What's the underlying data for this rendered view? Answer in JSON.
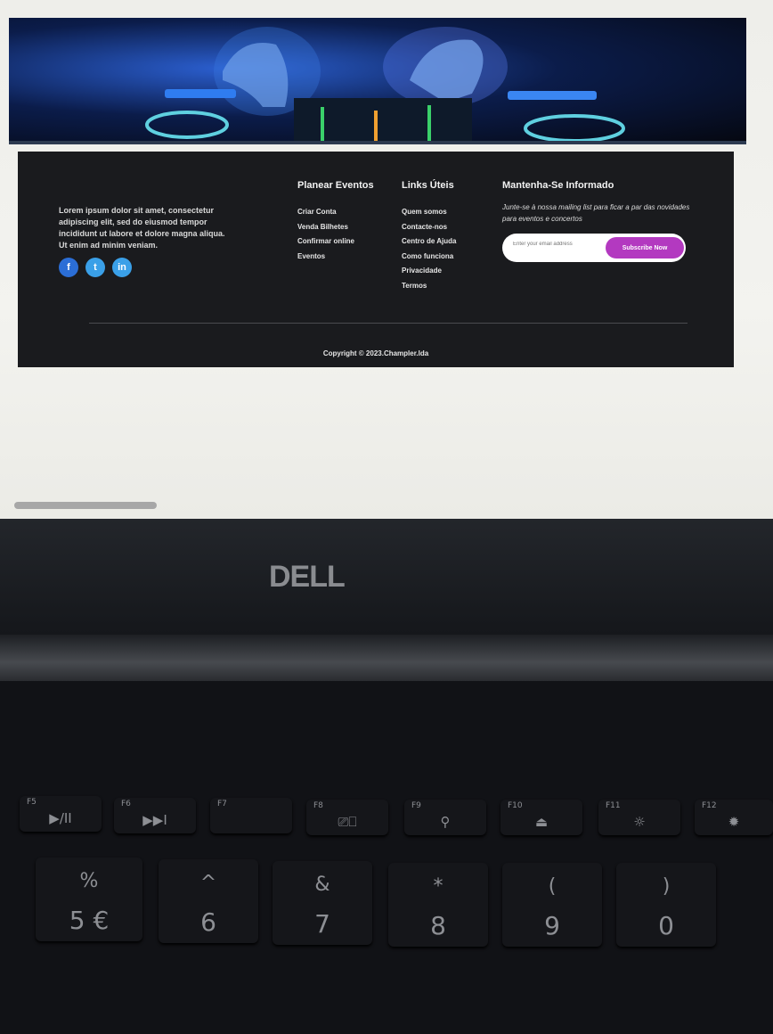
{
  "footer": {
    "about_text": "Lorem ipsum dolor sit amet, consectetur adipiscing elit, sed do eiusmod tempor incididunt ut labore et dolore magna aliqua. Ut enim ad minim veniam.",
    "socials": [
      {
        "label": "f",
        "icon": "facebook-icon"
      },
      {
        "label": "t",
        "icon": "twitter-icon"
      },
      {
        "label": "in",
        "icon": "linkedin-icon"
      }
    ],
    "plan": {
      "title": "Planear Eventos",
      "links": [
        "Criar Conta",
        "Venda Bilhetes",
        "Confirmar online",
        "Eventos"
      ]
    },
    "links": {
      "title": "Links Úteis",
      "links": [
        "Quem somos",
        "Contacte-nos",
        "Centro de Ajuda",
        "Como funciona",
        "Privacidade",
        "Termos"
      ]
    },
    "newsletter": {
      "title": "Mantenha-Se Informado",
      "text": "Junte-se à nossa mailing list para ficar a par das novidades para eventos e concertos",
      "placeholder": "Enter your email address",
      "button": "Subscribe Now"
    },
    "copyright": "Copyright © 2023.Champler.lda"
  },
  "laptop": {
    "brand": "DELL",
    "function_keys": [
      {
        "label": "F5",
        "glyph": "▶/II"
      },
      {
        "label": "F6",
        "glyph": "▶▶I"
      },
      {
        "label": "F7",
        "glyph": ""
      },
      {
        "label": "F8",
        "glyph": "⎚⎕"
      },
      {
        "label": "F9",
        "glyph": "⚲"
      },
      {
        "label": "F10",
        "glyph": "⏏"
      },
      {
        "label": "F11",
        "glyph": "☼"
      },
      {
        "label": "F12",
        "glyph": "✹"
      }
    ],
    "number_keys": [
      {
        "top": "%",
        "bottom": "5 €"
      },
      {
        "top": "^",
        "bottom": "6"
      },
      {
        "top": "&",
        "bottom": "7"
      },
      {
        "top": "*",
        "bottom": "8"
      },
      {
        "top": "(",
        "bottom": "9"
      },
      {
        "top": ")",
        "bottom": "0"
      }
    ]
  }
}
